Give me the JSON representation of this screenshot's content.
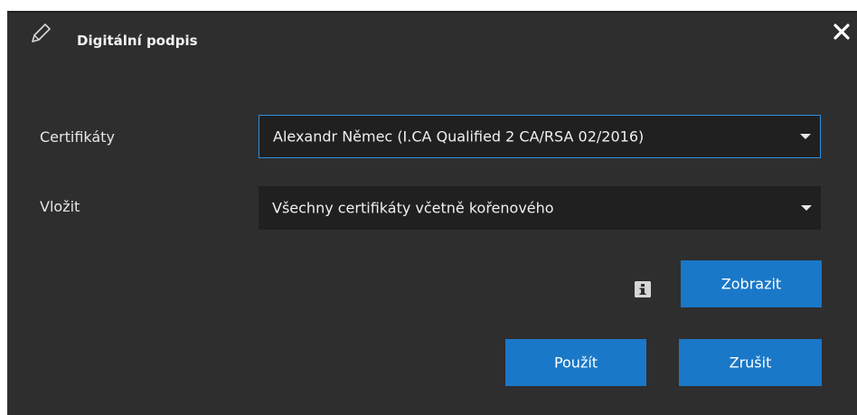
{
  "dialog": {
    "title": "Digitální podpis",
    "title_icon": "pencil-icon",
    "close_icon": "close-icon"
  },
  "fields": {
    "certificates": {
      "label": "Certifikáty",
      "value": "Alexandr Němec (I.CA Qualified 2 CA/RSA 02/2016)"
    },
    "embed": {
      "label": "Vložit",
      "value": "Všechny certifikáty včetně kořenového"
    }
  },
  "buttons": {
    "info_icon": "info-icon",
    "show": "Zobrazit",
    "apply": "Použít",
    "cancel": "Zrušit"
  },
  "colors": {
    "background": "#2e2e2e",
    "field_background": "#202020",
    "focus_border": "#2b8fe0",
    "button": "#1a78c8",
    "text": "#e8e8e8"
  }
}
